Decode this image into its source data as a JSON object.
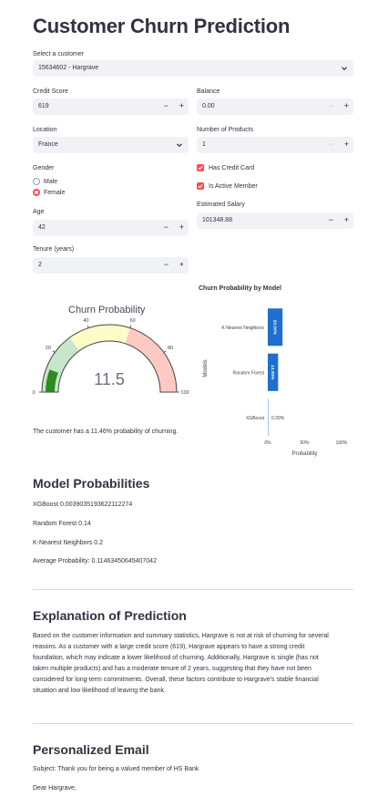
{
  "title": "Customer Churn Prediction",
  "select_customer": {
    "label": "Select a customer",
    "value": "15634602 - Hargrave"
  },
  "credit_score": {
    "label": "Credit Score",
    "value": "619"
  },
  "balance": {
    "label": "Balance",
    "value": "0.00"
  },
  "location": {
    "label": "Location",
    "value": "France"
  },
  "num_products": {
    "label": "Number of Products",
    "value": "1"
  },
  "gender": {
    "label": "Gender",
    "options": [
      "Male",
      "Female"
    ],
    "selected": "Female"
  },
  "has_credit_card": {
    "label": "Has Credit Card",
    "checked": true
  },
  "is_active_member": {
    "label": "Is Active Member",
    "checked": true
  },
  "estimated_salary": {
    "label": "Estimated Salary",
    "value": "101348.88"
  },
  "age": {
    "label": "Age",
    "value": "42"
  },
  "tenure": {
    "label": "Tenure (years)",
    "value": "2"
  },
  "gauge": {
    "title": "Churn Probability",
    "value": 11.5,
    "value_text": "11.5",
    "range": [
      0,
      100
    ],
    "ticks": [
      "0",
      "20",
      "40",
      "60",
      "80",
      "100"
    ],
    "bands": [
      {
        "from": 0,
        "to": 30,
        "color": "#c8e6c9"
      },
      {
        "from": 30,
        "to": 60,
        "color": "#fdfdc8"
      },
      {
        "from": 60,
        "to": 100,
        "color": "#ffc9c3"
      }
    ],
    "bar_color": "#2e8b22"
  },
  "chart_data": {
    "type": "bar",
    "title": "Churn Probability by Model",
    "orientation": "horizontal",
    "categories": [
      "K-Nearest Neighbors",
      "Random Forest",
      "XGBoost"
    ],
    "values": [
      0.2,
      0.14,
      0.0039
    ],
    "value_labels": [
      "20.00%",
      "14.00%",
      "0.39%"
    ],
    "xlabel": "Probability",
    "ylabel": "Models",
    "xticks": [
      "0%",
      "50%",
      "100%"
    ],
    "xlim": [
      0,
      1
    ],
    "bar_color": "#1f6fcf"
  },
  "churn_summary": "The customer has a 11.46% probability of churning.",
  "model_probabilities": {
    "heading": "Model Probabilities",
    "lines": [
      "XGBoost 0.0039035193622112274",
      "Random Forest 0.14",
      "K-Nearest Neighbors 0.2",
      "Average Probability: 0.11463450645407042"
    ]
  },
  "explanation": {
    "heading": "Explanation of Prediction",
    "lines": [
      "Based on the customer information and summary statistics, Hargrave is not at risk of churning for several",
      "reasons. As a customer with a large credit score (619), Hargrave appears to have a strong credit",
      "foundation, which may indicate a lower likelihood of churning. Additionally, Hargrave is single (has not",
      "taken multiple products) and has a moderate tenure of 2 years, suggesting that they have not been",
      "considered for long-term commitments. Overall, these factors contribute to Hargrave's stable financial",
      "situation and low likelihood of leaving the bank."
    ]
  },
  "email": {
    "heading": "Personalized Email",
    "subject": "Subject: Thank you for being a valued member of HS Bank",
    "greeting": "Dear Hargrave,"
  }
}
